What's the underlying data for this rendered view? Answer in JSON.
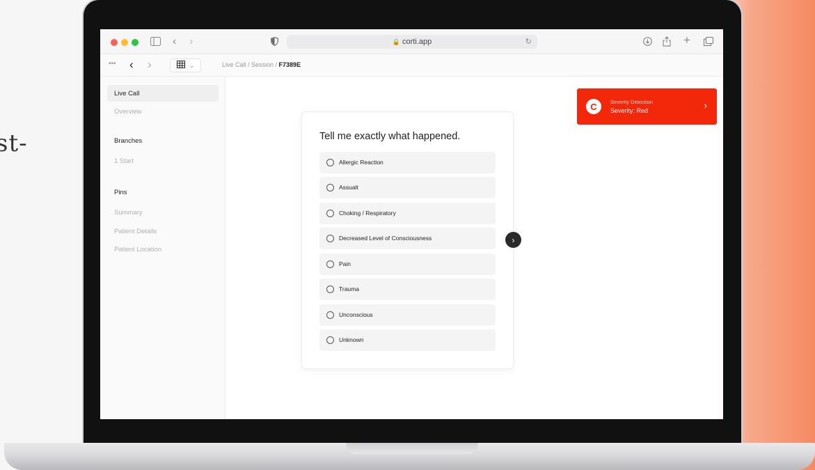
{
  "browser": {
    "url": "corti.app",
    "icons": [
      "sidebar-icon",
      "back-icon",
      "forward-icon",
      "shield-icon",
      "lock-icon",
      "reload-icon",
      "download-icon",
      "share-icon",
      "plus-icon",
      "tabs-icon"
    ]
  },
  "toolbar": {
    "more": "•••",
    "back": "‹",
    "forward": "›",
    "breadcrumb_prefix": "Live Call / Session / ",
    "breadcrumb_current": "F7389E"
  },
  "sidebar": {
    "live_call": "Live Call",
    "overview": "Overview",
    "branches_heading": "Branches",
    "branch_1": "1 Start",
    "pins_heading": "Pins",
    "pins": [
      "Summary",
      "Patient Details",
      "Patient Location"
    ]
  },
  "question": {
    "title": "Tell me exactly what happened.",
    "options": [
      "Allergic Reaction",
      "Assualt",
      "Choking / Respiratory",
      "Decreased Level of Consciousness",
      "Pain",
      "Trauma",
      "Unconscious",
      "Unknown"
    ]
  },
  "alert": {
    "label": "Severity Detection",
    "value": "Severity: Red",
    "logo": "C",
    "color": "#f3270a"
  },
  "background_text": "st-"
}
